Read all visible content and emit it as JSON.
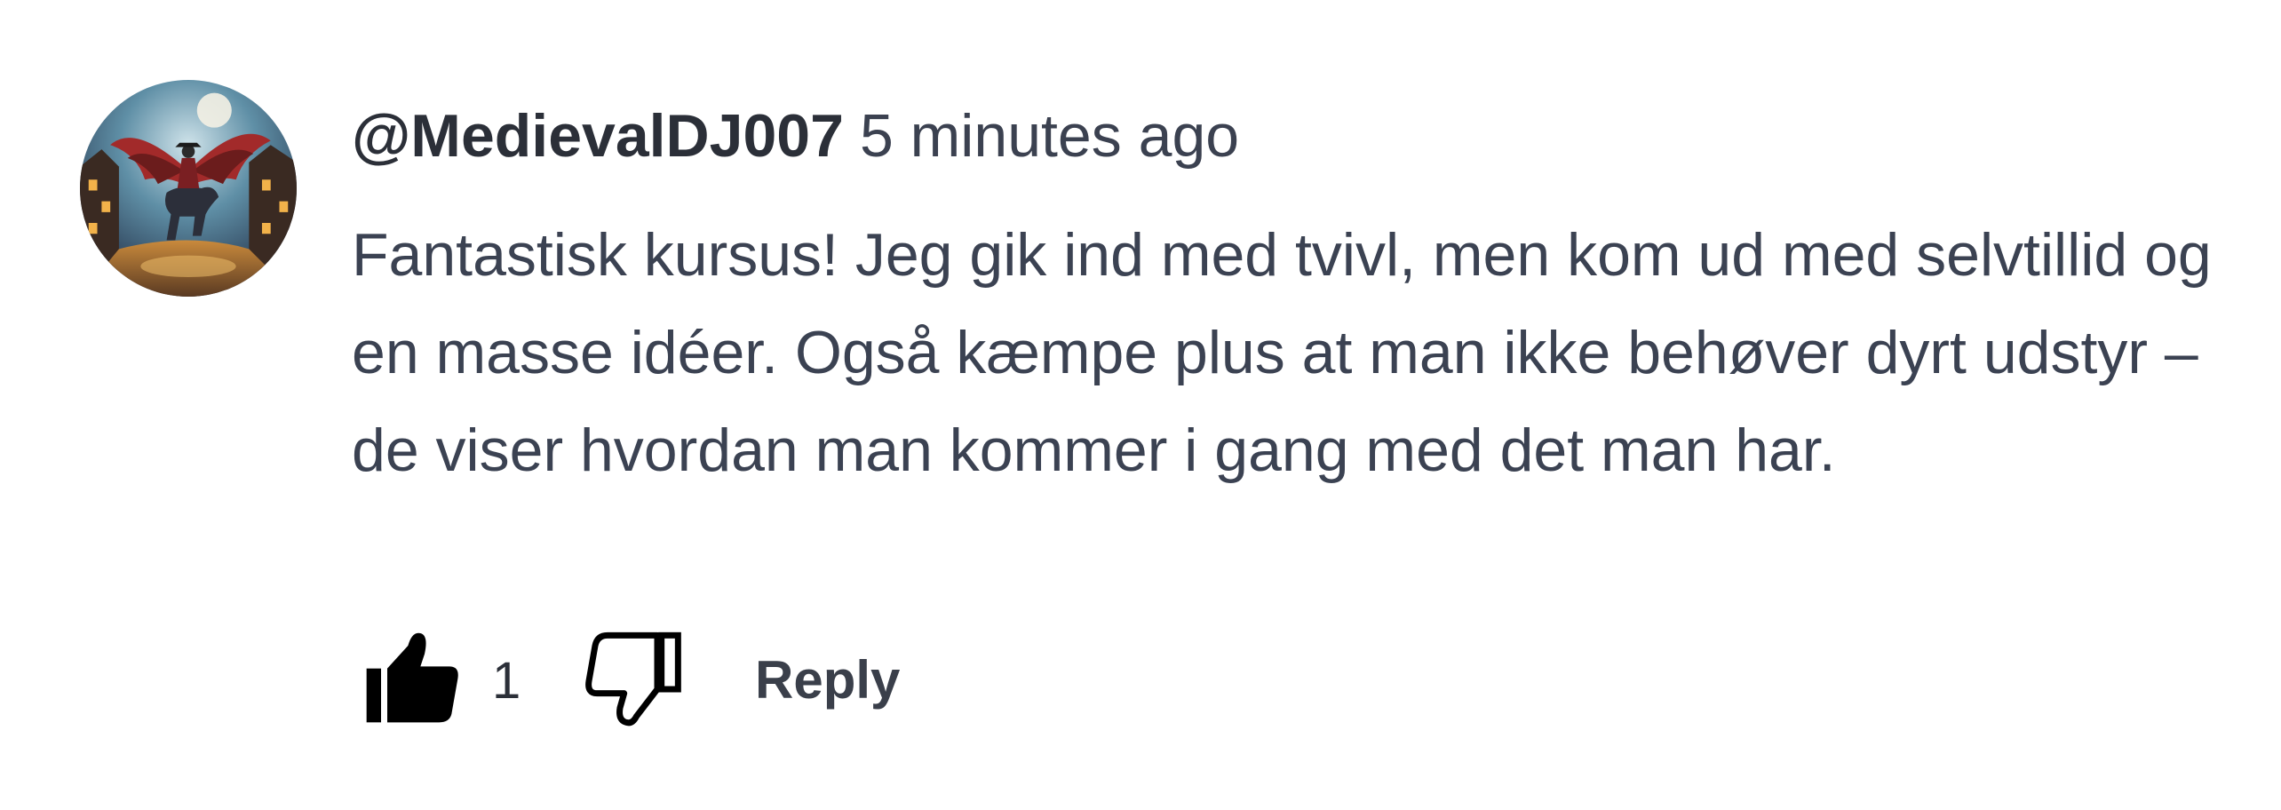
{
  "comment": {
    "username": "@MedievalDJ007",
    "timestamp": "5 minutes ago",
    "text": "Fantastisk kursus! Jeg gik ind med tvivl, men kom ud med selvtillid og en masse idéer. Også kæmpe plus at man ikke behøver dyrt udstyr – de viser hvordan man kommer i gang med det man har.",
    "avatar_icon": "fantasy-knight-avatar",
    "actions": {
      "like_icon": "thumbs-up-icon",
      "like_count": "1",
      "dislike_icon": "thumbs-down-icon",
      "reply_label": "Reply"
    }
  },
  "colors": {
    "text_primary": "#2b2f38",
    "text_body": "#3b4252",
    "background": "#ffffff"
  }
}
